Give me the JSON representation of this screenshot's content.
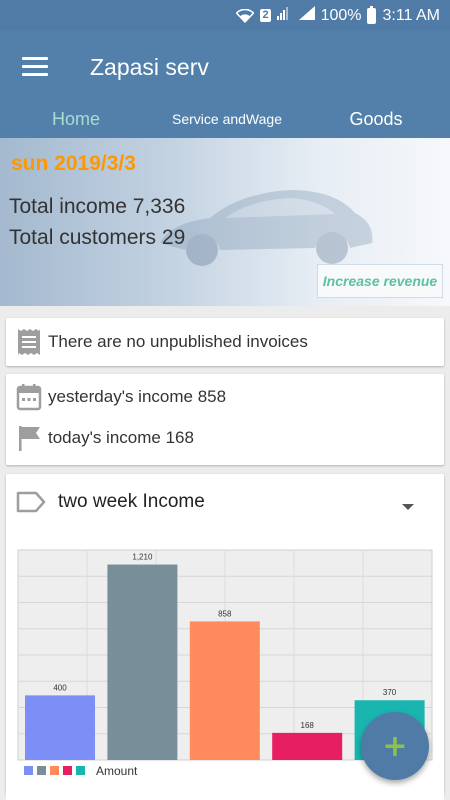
{
  "status": {
    "battery": "100%",
    "time": "3:11 AM",
    "badge": "2"
  },
  "app": {
    "title": "Zapasi serv"
  },
  "tabs": [
    {
      "label": "Home"
    },
    {
      "label": "Service andWage"
    },
    {
      "label": "Goods"
    }
  ],
  "hero": {
    "date": "sun 2019/3/3",
    "income": "Total income 7,336",
    "customers": "Total customers 29",
    "increase_label": "Increase revenue"
  },
  "invoices": {
    "text": "There are no unpublished invoices"
  },
  "income": {
    "yesterday": "yesterday's income 858",
    "today": "today's income 168"
  },
  "chart_section": {
    "title": "two week Income"
  },
  "chart_data": {
    "type": "bar",
    "values": [
      400,
      1210,
      858,
      168,
      370
    ],
    "labels": [
      "400",
      "1,210",
      "858",
      "168",
      "370"
    ],
    "colors": [
      "#7b8ff6",
      "#788f9a",
      "#ff8a5c",
      "#e81e63",
      "#1bb5b0"
    ],
    "legend": "Amount",
    "ylim": [
      0,
      1300
    ],
    "grid": true,
    "legend_position": "bottom-left"
  },
  "colors": {
    "primary": "#5280aa",
    "accent_date": "#ff9800",
    "fab_icon": "#8bc34a"
  }
}
